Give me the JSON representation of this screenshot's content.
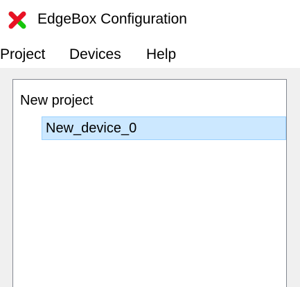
{
  "window": {
    "title": "EdgeBox Configuration",
    "icon": "red-green-x-icon",
    "icon_colors": {
      "red": "#e81224",
      "green": "#16c60c"
    }
  },
  "menubar": {
    "items": [
      {
        "label": "Project"
      },
      {
        "label": "Devices"
      },
      {
        "label": "Help"
      }
    ]
  },
  "tree": {
    "root_label": "New project",
    "children": [
      {
        "label": "New_device_0",
        "selected": true
      }
    ],
    "selection_color": "#cce8ff"
  }
}
